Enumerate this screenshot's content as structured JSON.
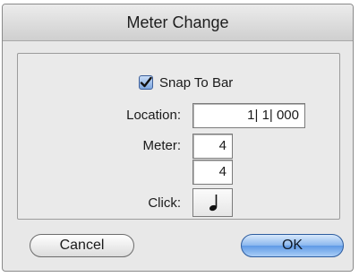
{
  "dialog": {
    "title": "Meter Change",
    "snap_to_bar": {
      "label": "Snap To Bar",
      "checked": true
    },
    "location": {
      "label": "Location:",
      "value": "1| 1| 000"
    },
    "meter": {
      "label": "Meter:",
      "numerator": "4",
      "denominator": "4"
    },
    "click": {
      "label": "Click:",
      "icon": "quarter-note-icon"
    },
    "buttons": {
      "cancel": "Cancel",
      "ok": "OK"
    }
  },
  "colors": {
    "accent": "#5f9ae6",
    "checkbox": "#7ea7e0",
    "window_bg": "#e8e8e8"
  }
}
